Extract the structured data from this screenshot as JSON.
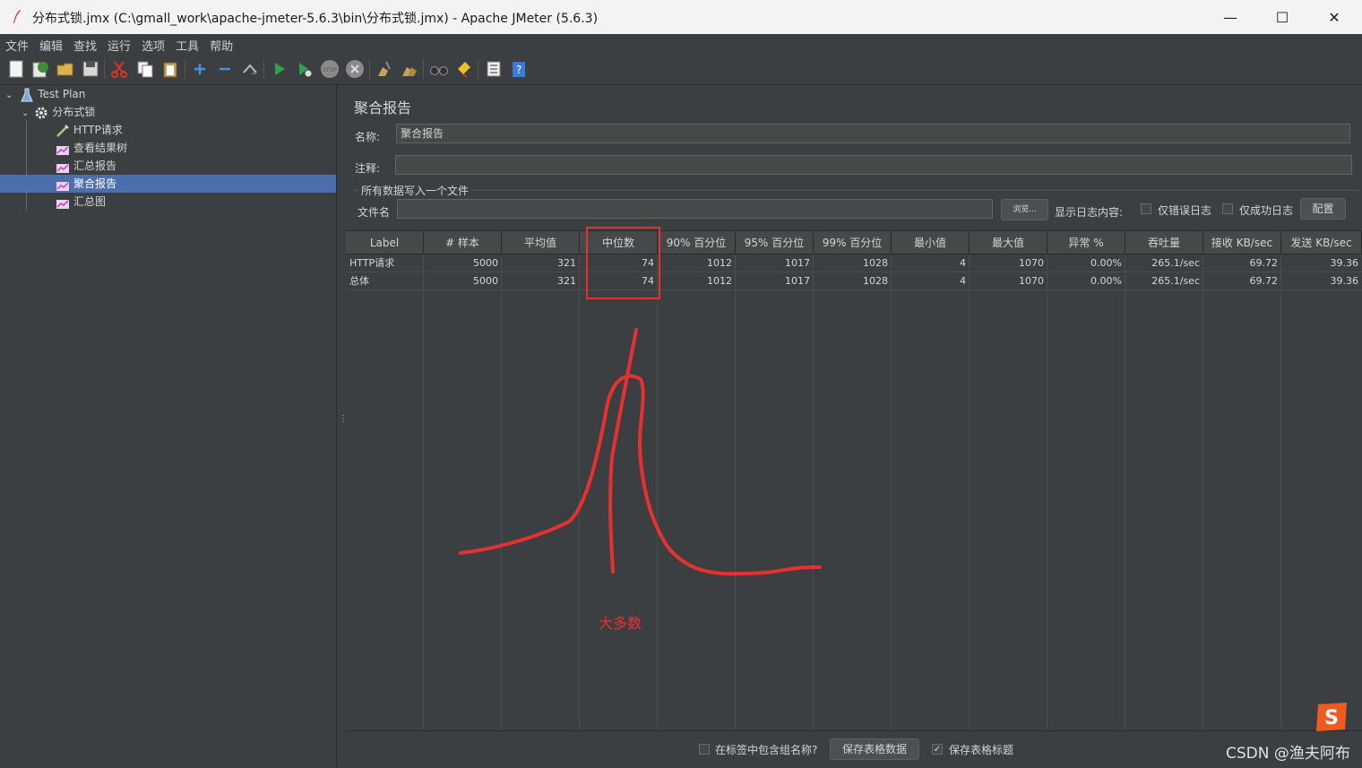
{
  "window": {
    "title": "分布式锁.jmx (C:\\gmall_work\\apache-jmeter-5.6.3\\bin\\分布式锁.jmx) - Apache JMeter (5.6.3)",
    "minimize_glyph": "—",
    "maximize_glyph": "☐",
    "close_glyph": "✕"
  },
  "menu": [
    "文件",
    "编辑",
    "查找",
    "运行",
    "选项",
    "工具",
    "帮助"
  ],
  "toolbar": [
    {
      "name": "new-icon"
    },
    {
      "name": "templates-icon"
    },
    {
      "name": "open-icon"
    },
    {
      "name": "save-icon"
    },
    {
      "name": "cut-icon"
    },
    {
      "name": "copy-icon"
    },
    {
      "name": "paste-icon"
    },
    {
      "name": "expand-icon"
    },
    {
      "name": "collapse-icon"
    },
    {
      "name": "toggle-icon"
    },
    {
      "name": "start-icon"
    },
    {
      "name": "start-no-pause-icon"
    },
    {
      "name": "stop-icon"
    },
    {
      "name": "shutdown-icon"
    },
    {
      "name": "clear-icon"
    },
    {
      "name": "clear-all-icon"
    },
    {
      "name": "search-icon"
    },
    {
      "name": "reset-search-icon"
    },
    {
      "name": "function-helper-icon"
    },
    {
      "name": "help-icon"
    }
  ],
  "tree": {
    "items": [
      {
        "label": "Test Plan",
        "icon": "test-plan-icon"
      },
      {
        "label": "分布式锁",
        "icon": "thread-group-gear-icon"
      },
      {
        "label": "HTTP请求",
        "icon": "http-sampler-icon"
      },
      {
        "label": "查看结果树",
        "icon": "listener-graph-icon"
      },
      {
        "label": "汇总报告",
        "icon": "listener-graph-icon"
      },
      {
        "label": "聚合报告",
        "icon": "listener-graph-icon",
        "selected": true
      },
      {
        "label": "汇总图",
        "icon": "listener-graph-icon"
      }
    ]
  },
  "panel": {
    "title": "聚合报告",
    "name_label": "名称:",
    "name_value": "聚合报告",
    "comment_label": "注释:",
    "comment_value": "",
    "file_group_label": "所有数据写入一个文件",
    "filename_label": "文件名",
    "filename_value": "",
    "browse_label": "浏览...",
    "log_label": "显示日志内容:",
    "errors_only_label": "仅错误日志",
    "success_only_label": "仅成功日志",
    "configure_label": "配置"
  },
  "table": {
    "headers": [
      "Label",
      "# 样本",
      "平均值",
      "中位数",
      "90% 百分位",
      "95% 百分位",
      "99% 百分位",
      "最小值",
      "最大值",
      "异常 %",
      "吞吐量",
      "接收 KB/sec",
      "发送 KB/sec"
    ],
    "rows": [
      [
        "HTTP请求",
        "5000",
        "321",
        "74",
        "1012",
        "1017",
        "1028",
        "4",
        "1070",
        "0.00%",
        "265.1/sec",
        "69.72",
        "39.36"
      ],
      [
        "总体",
        "5000",
        "321",
        "74",
        "1012",
        "1017",
        "1028",
        "4",
        "1070",
        "0.00%",
        "265.1/sec",
        "69.72",
        "39.36"
      ]
    ]
  },
  "bottom": {
    "include_group_label": "在标签中包含组名称?",
    "save_table_label": "保存表格数据",
    "save_header_label": "保存表格标题",
    "save_header_checked": true
  },
  "annotation": {
    "text": "大多数",
    "color": "#e8312f"
  },
  "watermark": {
    "text": "CSDN @渔夫阿布",
    "logo_letter": "S"
  },
  "colors": {
    "background": "#3c3f41",
    "selection": "#4b6eaf",
    "annotation": "#e8312f"
  }
}
